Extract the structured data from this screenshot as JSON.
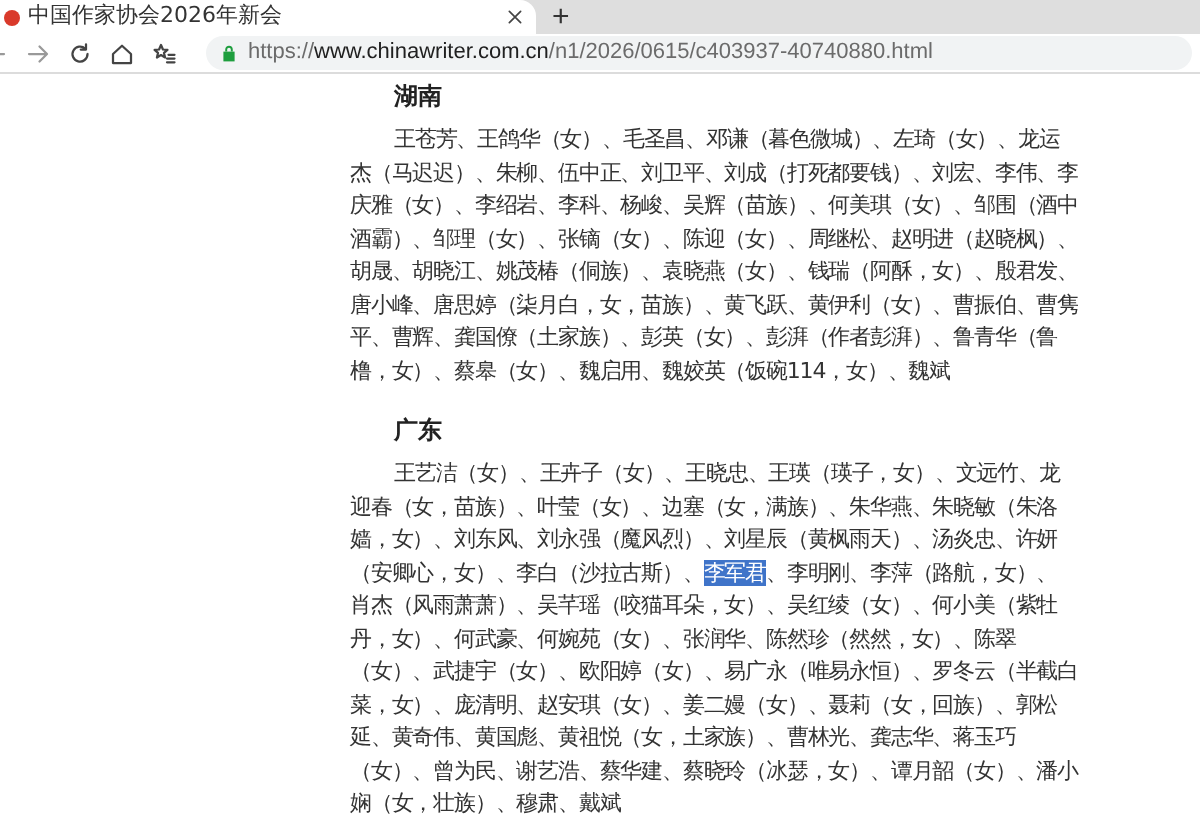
{
  "tab": {
    "title": "中国作家协会2026年新会",
    "selected": true
  },
  "new_tab": "+",
  "address_bar": {
    "scheme": "https://",
    "host": "www.chinawriter.com.cn",
    "path": "/n1/2026/0615/c403937-40740880.html"
  },
  "sections": [
    {
      "heading": "湖南",
      "paragraph": [
        {
          "text": "王苍芳、王鸽华（女）、毛圣昌、邓谦（暮色微城）、左琦（女）、龙运杰（马迟迟）、朱柳、伍中正、刘卫平、刘成（打死都要钱）、刘宏、李伟、李庆雅（女）、李绍岩、李科、杨峻、吴辉（苗族）、何美琪（女）、邹围（酒中酒霸）、邹理（女）、张镝（女）、陈迎（女）、周继松、赵明进（赵晓枫）、胡晟、胡晓江、姚茂椿（侗族）、袁晓燕（女）、钱瑞（阿酥，女）、殷君发、唐小峰、唐思婷（柒月白，女，苗族）、黄飞跃、黄伊利（女）、曹振伯、曹隽平、曹辉、龚国僚（土家族）、彭英（女）、彭湃（作者彭湃）、鲁青华（鲁橹，女）、蔡皋（女）、魏启用、魏姣英（饭碗114，女）、魏斌",
          "selected": false
        }
      ]
    },
    {
      "heading": "广东",
      "paragraph": [
        {
          "text": "王艺洁（女）、王卉子（女）、王晓忠、王瑛（瑛子，女）、文远竹、龙迎春（女，苗族）、叶莹（女）、边塞（女，满族）、朱华燕、朱晓敏（朱洛嫱，女）、刘东风、刘永强（魔风烈）、刘星辰（黄枫雨天）、汤炎忠、许妍（安卿心，女）、李白（沙拉古斯）、",
          "selected": false
        },
        {
          "text": "李军君",
          "selected": true
        },
        {
          "text": "、李明刚、李萍（路航，女）、肖杰（风雨萧萧）、吴芊瑶（咬猫耳朵，女）、吴红绫（女）、何小美（紫牡丹，女）、何武豪、何婉苑（女）、张润华、陈然珍（然然，女）、陈翠（女）、武捷宇（女）、欧阳婷（女）、易广永（唯易永恒）、罗冬云（半截白菜，女）、庞清明、赵安琪（女）、姜二嫚（女）、聂莉（女，回族）、郭松延、黄奇伟、黄国彪、黄祖悦（女，土家族）、曹林光、龚志华、蒋玉巧（女）、曾为民、谢艺浩、蔡华建、蔡晓玲（冰瑟，女）、谭月韶（女）、潘小娴（女，壮族）、穆肃、戴斌",
          "selected": false
        }
      ]
    }
  ]
}
